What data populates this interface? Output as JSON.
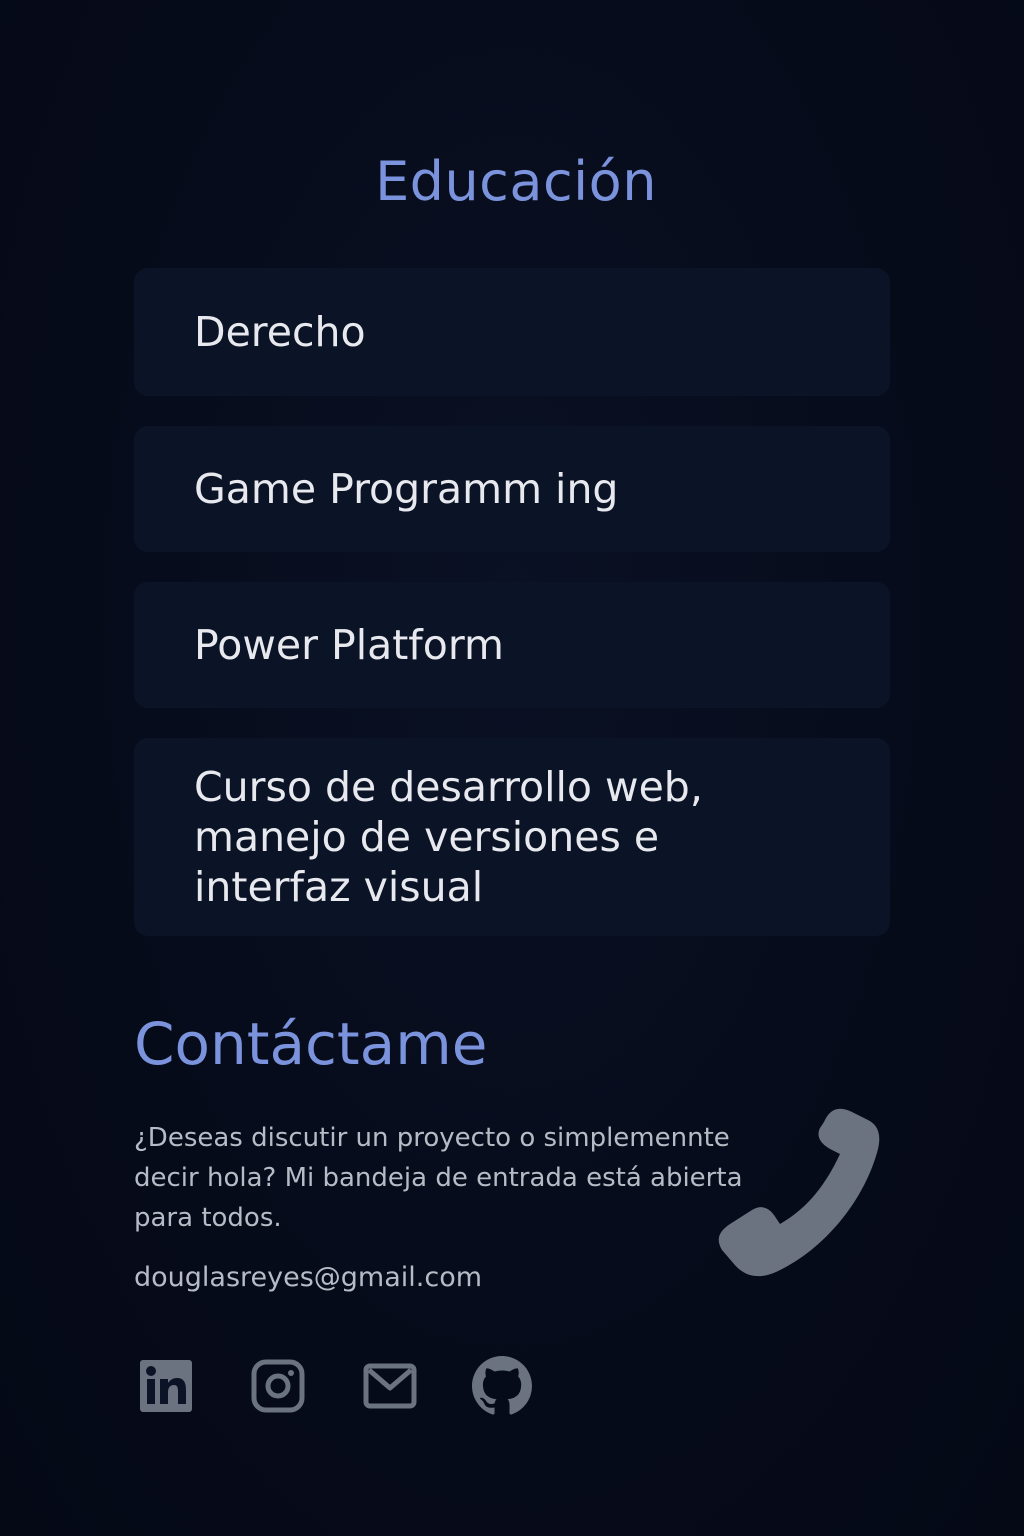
{
  "education": {
    "title": "Educación",
    "items": [
      "Derecho",
      "Game Programm ing",
      "Power Platform",
      "Curso de desarrollo web,\nmanejo de versiones e\ninterfaz visual"
    ]
  },
  "contact": {
    "title": "Contáctame",
    "text": "¿Deseas discutir un proyecto o simplemennte decir hola? Mi bandeja de entrada está abierta para todos.",
    "email": "douglasreyes@gmail.com",
    "icon": "phone-icon"
  },
  "socials": [
    {
      "icon": "linkedin-icon"
    },
    {
      "icon": "instagram-icon"
    },
    {
      "icon": "mail-icon"
    },
    {
      "icon": "github-icon"
    }
  ],
  "colors": {
    "background": "#060b1a",
    "card": "#0b1426",
    "accent": "#7b93dc",
    "text": "#e8e9ee",
    "muted": "#b7bbc5",
    "icon": "#6b7280"
  }
}
